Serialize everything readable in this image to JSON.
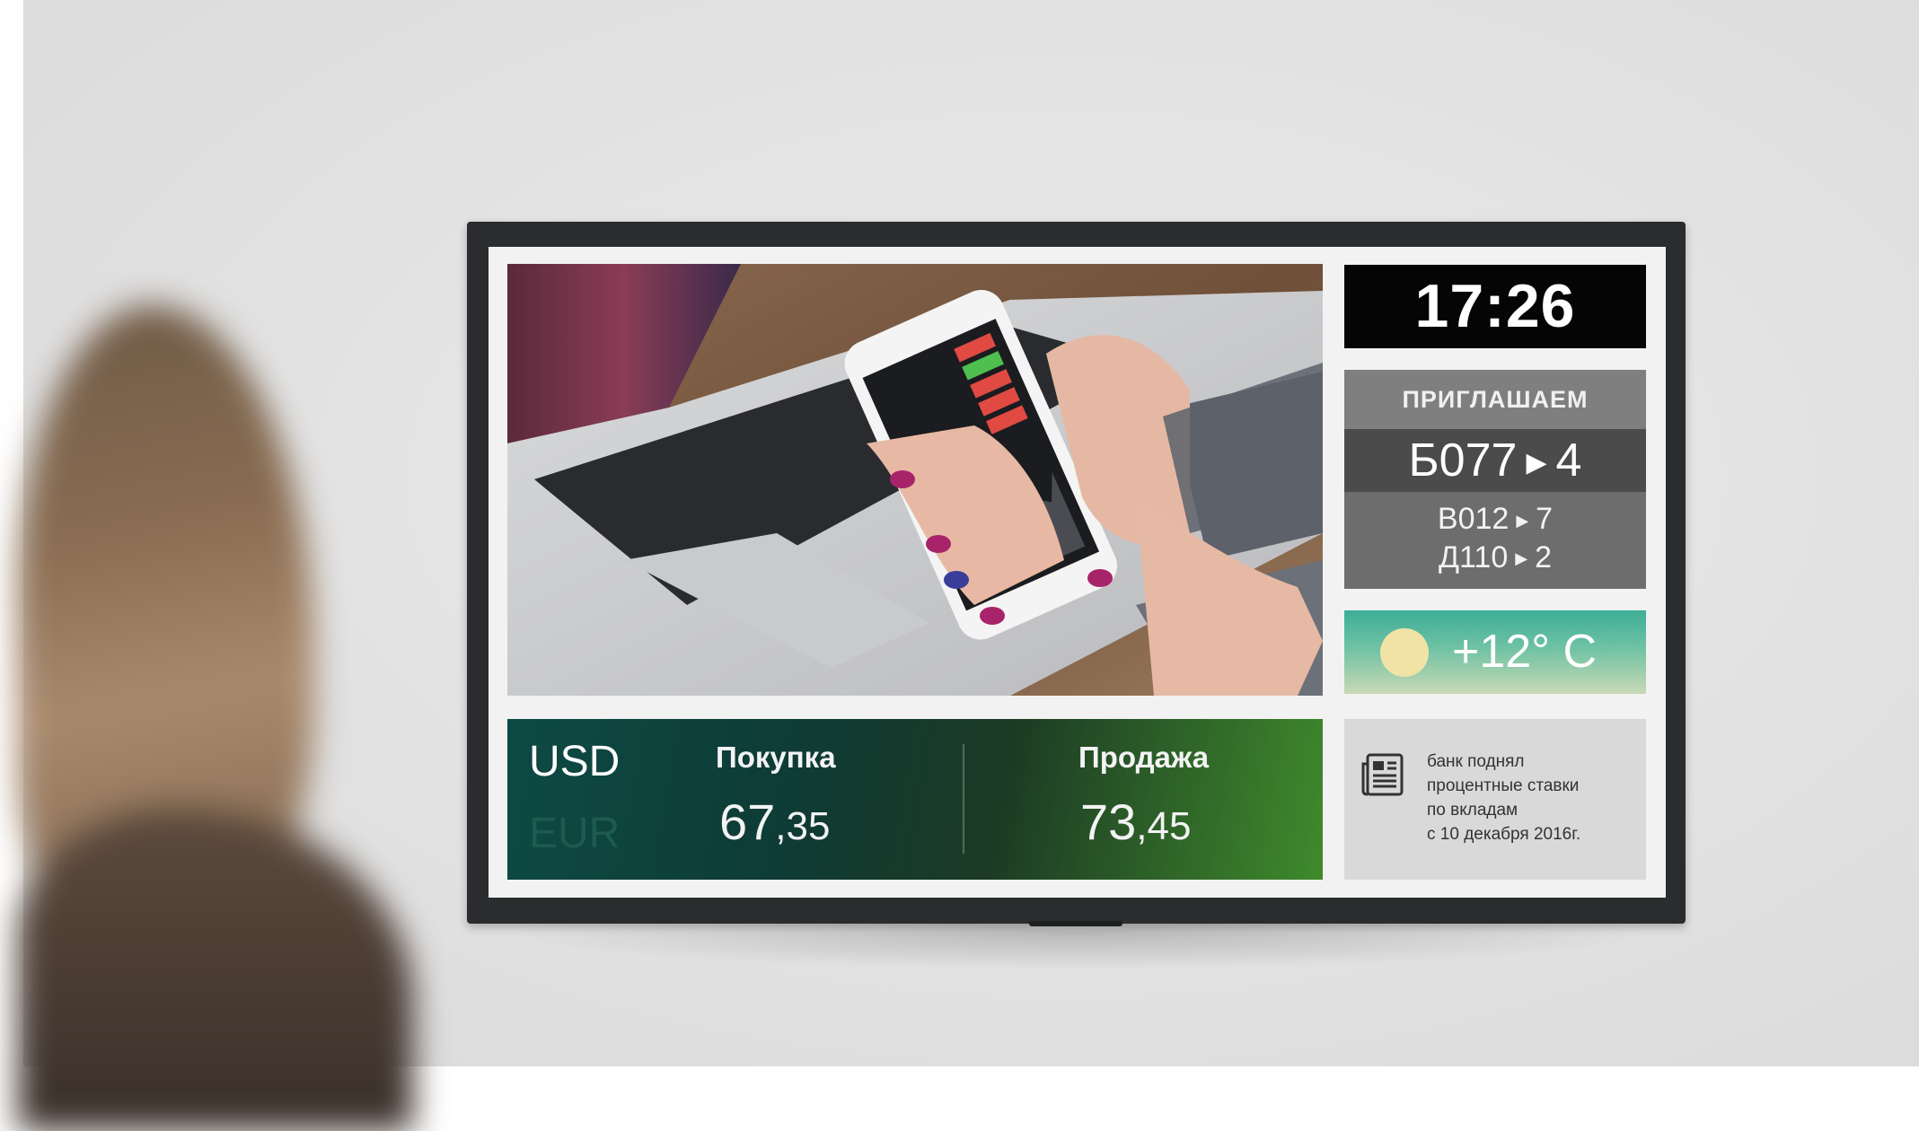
{
  "display": {
    "clock": "17:26",
    "queue": {
      "heading": "ПРИГЛАШАЕМ",
      "current_ticket": "Б077",
      "current_window": "4",
      "next": [
        {
          "ticket": "В012",
          "window": "7"
        },
        {
          "ticket": "Д110",
          "window": "2"
        }
      ],
      "arrow_icon": "play-arrow-icon"
    },
    "weather": {
      "temperature": "+12° C",
      "icon": "sun-icon"
    },
    "currency": {
      "active": "USD",
      "inactive": "EUR",
      "buy_label": "Покупка",
      "buy_value_int": "67",
      "buy_value_frac": ",35",
      "sell_label": "Продажа",
      "sell_value_int": "73",
      "sell_value_frac": ",45"
    },
    "news": {
      "icon": "newspaper-icon",
      "lines": [
        "банк поднял",
        "процентные ставки",
        "по вкладам",
        "с 10 декабря 2016г."
      ]
    },
    "colors": {
      "clock_bg": "#050505",
      "queue_head_bg": "#7f7f7f",
      "queue_main_bg": "#4b4b4b",
      "currency_gradient_start": "#0e4a45",
      "currency_gradient_end": "#3f8a2c",
      "weather_gradient_start": "#3cae96"
    }
  }
}
